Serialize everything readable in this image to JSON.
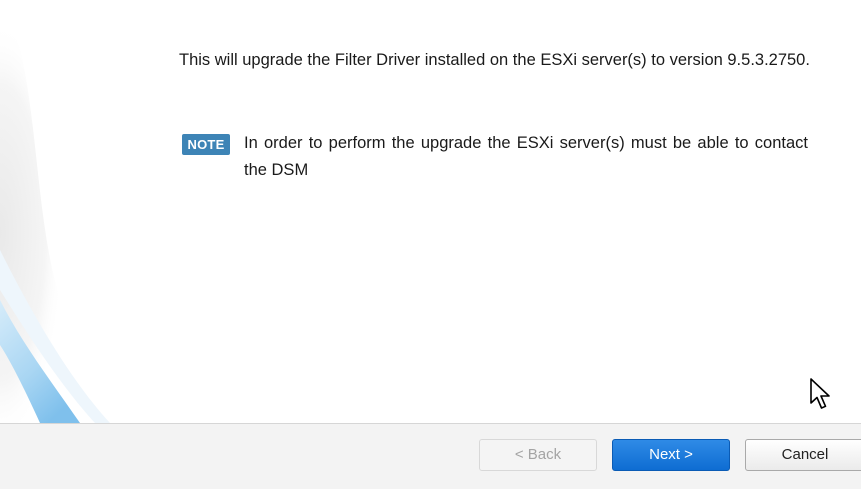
{
  "intro_text": "This will upgrade the Filter Driver installed on the ESXi server(s) to version 9.5.3.2750.",
  "note": {
    "badge_label": "NOTE",
    "text": "In order to perform the upgrade the ESXi server(s) must be able to contact the DSM"
  },
  "buttons": {
    "back_label": "< Back",
    "back_enabled": false,
    "next_label": "Next >",
    "cancel_label": "Cancel"
  },
  "colors": {
    "note_badge": "#3d84b6",
    "primary_button": "#1479dc",
    "decor_swoosh": "#a9d6f3"
  },
  "icons": {
    "cursor": "mouse-pointer-icon"
  }
}
